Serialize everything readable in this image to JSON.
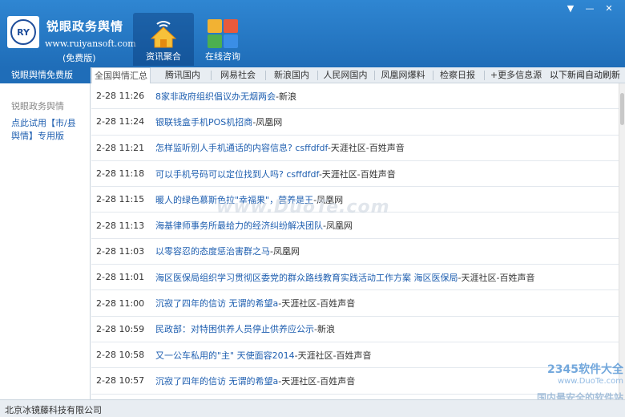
{
  "app": {
    "logo_text": "RY",
    "title": "锐眼政务舆情",
    "site": "www.ruiyansoft.com",
    "edition": "(免费版)"
  },
  "nav": {
    "items": [
      {
        "label": "资讯聚合",
        "icon": "home-icon",
        "active": true
      },
      {
        "label": "在线咨询",
        "icon": "app-grid-icon",
        "active": false
      }
    ]
  },
  "window_controls": {
    "menu": "▼",
    "minimize": "—",
    "close": "✕"
  },
  "sidebar": {
    "tab_label": "锐眼舆情免费版",
    "heading": "锐眼政务舆情",
    "link": "点此试用【市/县舆情】专用版"
  },
  "tabs": [
    {
      "label": "全国舆情汇总",
      "active": true
    },
    {
      "label": "腾讯国内"
    },
    {
      "label": "网易社会"
    },
    {
      "label": "新浪国内"
    },
    {
      "label": "人民网国内"
    },
    {
      "label": "凤凰网爆料"
    },
    {
      "label": "检察日报"
    },
    {
      "label": "+更多信息源"
    }
  ],
  "auto_refresh": "以下新闻自动刷新",
  "news": [
    {
      "time": "2-28 11:26",
      "title": "8家非政府组织倡议办无烟两会",
      "source": "-新浪"
    },
    {
      "time": "2-28 11:24",
      "title": "银联钱盒手机POS机招商",
      "source": "-凤凰网"
    },
    {
      "time": "2-28 11:21",
      "title": "怎样监听别人手机通话的内容信息? csffdfdf",
      "source": "-天涯社区-百姓声音"
    },
    {
      "time": "2-28 11:18",
      "title": "可以手机号码可以定位找到人吗? csffdfdf",
      "source": "-天涯社区-百姓声音"
    },
    {
      "time": "2-28 11:15",
      "title": "暖人的绿色慕斯色拉\"幸福果\"，营养是王",
      "source": "-凤凰网"
    },
    {
      "time": "2-28 11:13",
      "title": "海基律师事务所最给力的经济纠纷解决团队",
      "source": "-凤凰网"
    },
    {
      "time": "2-28 11:03",
      "title": "以零容忍的态度惩治害群之马",
      "source": "-凤凰网"
    },
    {
      "time": "2-28 11:01",
      "title": "海区医保局组织学习贯彻区委党的群众路线教育实践活动工作方案 海区医保局",
      "source": "-天涯社区-百姓声音"
    },
    {
      "time": "2-28 11:00",
      "title": "沉寂了四年的信访 无谓的希望a",
      "source": "-天涯社区-百姓声音"
    },
    {
      "time": "2-28 10:59",
      "title": "民政部：对特困供养人员停止供养应公示",
      "source": "-新浪"
    },
    {
      "time": "2-28 10:58",
      "title": "又一公车私用的\"主\" 天使面容2014",
      "source": "-天涯社区-百姓声音"
    },
    {
      "time": "2-28 10:57",
      "title": "沉寂了四年的信访 无谓的希望a",
      "source": "-天涯社区-百姓声音"
    }
  ],
  "status": "北京冰镜藤科技有限公司",
  "watermarks": {
    "center": "www.DuoTe.com",
    "brand": "2345软件大全",
    "url": "www.DuoTe.com",
    "slogan": "国内最安全的软件站"
  },
  "colors": {
    "header": "#2a7ec9",
    "link": "#1f5fb0",
    "sidebar_tab": "#1f6db8"
  }
}
